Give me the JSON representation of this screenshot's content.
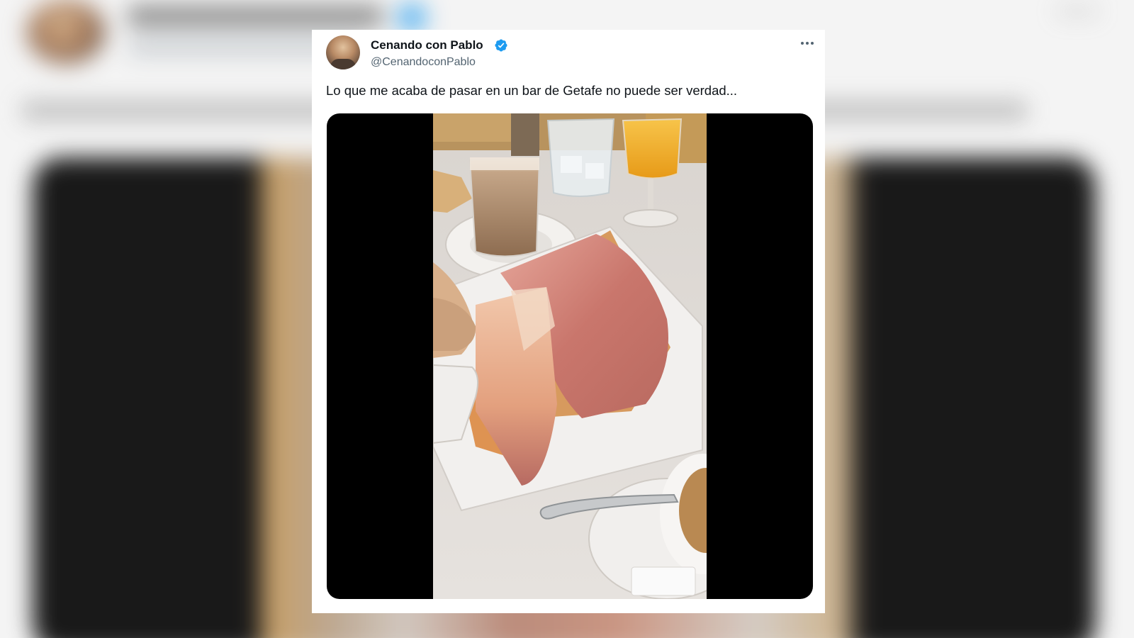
{
  "tweet": {
    "author": {
      "display_name": "Cenando con Pablo",
      "handle": "@CenandoconPablo",
      "verified": true,
      "avatar_icon": "profile-photo"
    },
    "text": "Lo que me acaba de pasar en un bar de Getafe no puede ser verdad...",
    "more_icon": "more-options-icon",
    "media": {
      "type": "video",
      "subject": "photo"
    }
  },
  "colors": {
    "verified_badge": "#1d9bf0",
    "text_primary": "#0f1419",
    "text_secondary": "#536471",
    "media_background": "#000000"
  }
}
